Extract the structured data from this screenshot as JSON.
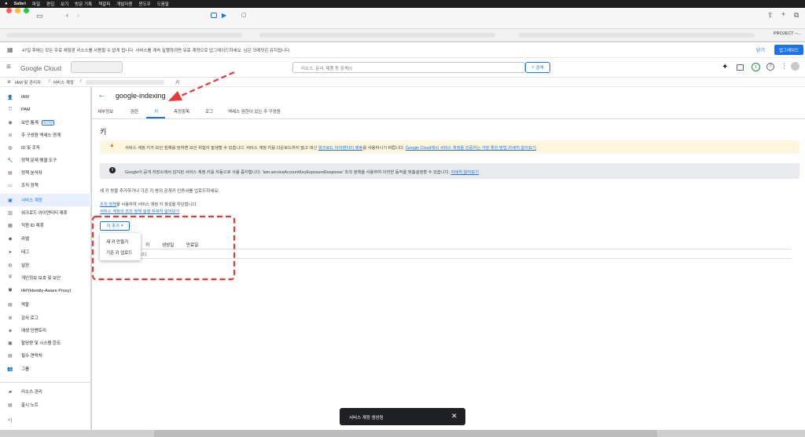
{
  "macos": {
    "menu": [
      "Safari",
      "파일",
      "편집",
      "보기",
      "방문 기록",
      "책갈피",
      "개발자용",
      "윈도우",
      "도움말"
    ]
  },
  "browser": {
    "address_tab_label": "PROJECT –..."
  },
  "banner": {
    "text": "47일 후에는 모든 무료 체험판 리소스를 사용할 수 없게 됩니다. 서비스를 계속 실행하려면 유료 계정으로 업그레이드하세요. 남은 크레딧은 유지됩니다.",
    "close": "닫기",
    "upgrade": "업그레이드"
  },
  "header": {
    "logo": "Google Cloud",
    "search_placeholder": "리소스, 문서, 제품 등 검색(/)",
    "search_button": "검색",
    "avatar_letter": "1"
  },
  "breadcrumb": {
    "root": "IAM 및 관리자",
    "sep": "/",
    "service_accounts": "서비스 계정",
    "current": "키"
  },
  "sidebar": {
    "items": [
      {
        "label": "IAM",
        "icon": "person-add-icon"
      },
      {
        "label": "PAM",
        "icon": "shield-icon"
      },
      {
        "label": "보안 통계",
        "icon": "insights-icon",
        "badge": "프리뷰"
      },
      {
        "label": "주 구성원 액세스 경계",
        "icon": "boundary-icon"
      },
      {
        "label": "ID 및 조직",
        "icon": "id-icon"
      },
      {
        "label": "정책 문제 해결 도구",
        "icon": "wrench-icon"
      },
      {
        "label": "정책 분석자",
        "icon": "analyzer-icon"
      },
      {
        "label": "조직 정책",
        "icon": "document-icon"
      },
      {
        "label": "서비스 계정",
        "icon": "service-account-icon",
        "active": true
      },
      {
        "label": "워크로드 아이덴티티 제휴",
        "icon": "workload-icon"
      },
      {
        "label": "직원 ID 제휴",
        "icon": "workforce-icon"
      },
      {
        "label": "라벨",
        "icon": "label-icon"
      },
      {
        "label": "태그",
        "icon": "tag-icon"
      },
      {
        "label": "설정",
        "icon": "gear-icon"
      },
      {
        "label": "개인정보 보호 및 보안",
        "icon": "privacy-icon"
      },
      {
        "label": "IAP(Identity-Aware Proxy)",
        "icon": "iap-icon"
      },
      {
        "label": "역할",
        "icon": "roles-icon"
      },
      {
        "label": "감사 로그",
        "icon": "audit-icon"
      },
      {
        "label": "애셋 인벤토리",
        "icon": "inventory-icon"
      },
      {
        "label": "할당량 및 시스템 한도",
        "icon": "quota-icon"
      },
      {
        "label": "필수 연락처",
        "icon": "contacts-icon"
      },
      {
        "label": "그룹",
        "icon": "groups-icon"
      }
    ],
    "bottom": [
      {
        "label": "리소스 관리",
        "icon": "folder-icon"
      },
      {
        "label": "출시 노트",
        "icon": "notes-icon"
      }
    ],
    "collapse": "<|"
  },
  "page": {
    "title": "google-indexing",
    "tabs": [
      "세부정보",
      "권한",
      "키",
      "측정항목",
      "로그",
      "액세스 권한이 있는 주 구성원"
    ],
    "selected_tab": "키",
    "section_title": "키",
    "warning": {
      "text_a": "서비스 계정 키가 보안 침해를 당하면 보안 위험이 발생할 수 있습니다. 서비스 계정 키를 다운로드하지 말고 대신 ",
      "link_a": "워크로드 아이덴티티 제휴",
      "text_b": "를 사용하시기 바랍니다. ",
      "link_b": "Google Cloud에서 서비스 계정을 인증하는 가장 좋은 방법 자세히 알아보기"
    },
    "info": {
      "text": "Google이 공개 저장소에서 감지된 서비스 계정 키를 자동으로 사용 중지합니다. 'iam.serviceAccountKeyExposureResponse' 조직 정책을 사용하여 이러한 동작을 맞춤설정할 수 있습니다. ",
      "link": "자세히 알아보기"
    },
    "description": "새 키 쌍을 추가하거나 기존 키 쌍의 공개키 인증서를 업로드하세요.",
    "policy_line_link": "조직 정책",
    "policy_line_text": "을 사용하여 서비스 계정 키 생성을 차단합니다.",
    "policy_learn": "서비스 계정의 조직 정책 설정 자세히 알아보기",
    "add_key": "키 추가",
    "menu": [
      "새 키 만들기",
      "기존 키 업로드"
    ],
    "table_headers": [
      "키",
      "생성일",
      "만료일"
    ],
    "empty_text": "니다."
  },
  "toast": {
    "text": "서비스 계정 생성됨",
    "close": "✕"
  },
  "colors": {
    "accent": "#1a73e8",
    "annotation": "#e53935",
    "warning_bg": "#fef7e0"
  }
}
